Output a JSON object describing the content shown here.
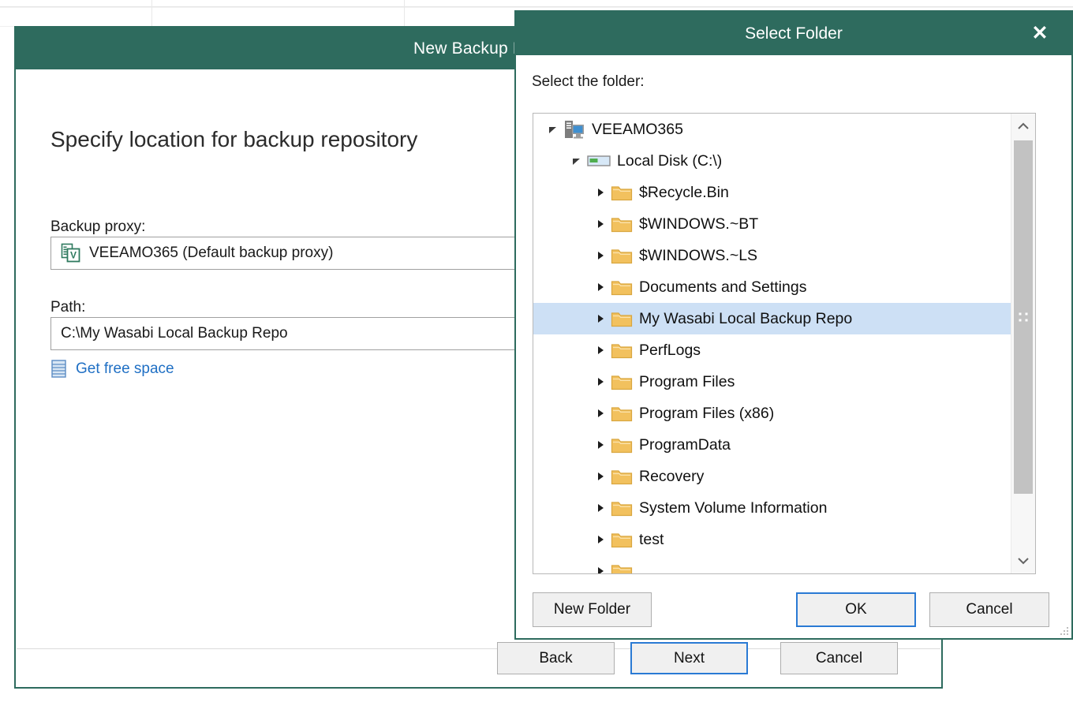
{
  "background": {
    "grid_lines_color": "#e8e8e8"
  },
  "wizard": {
    "title": "New Backup Rep",
    "heading": "Specify location for backup repository",
    "proxy": {
      "label": "Backup proxy:",
      "icon": "veeam-proxy-icon",
      "value": "VEEAMO365 (Default backup proxy)"
    },
    "path": {
      "label": "Path:",
      "value": "C:\\My Wasabi Local Backup Repo"
    },
    "free_space": {
      "icon": "database-icon",
      "label": "Get free space"
    },
    "buttons": {
      "back": "Back",
      "next": "Next",
      "cancel": "Cancel"
    },
    "accent_color": "#2e6b5e",
    "focus_color": "#2a7ad4"
  },
  "folder_dialog": {
    "title": "Select Folder",
    "close_icon": "close-icon",
    "prompt": "Select the folder:",
    "tree": [
      {
        "label": "VEEAMO365",
        "indent": 0,
        "icon": "computer-icon",
        "twisty": "expanded",
        "selected": false
      },
      {
        "label": "Local Disk (C:\\)",
        "indent": 1,
        "icon": "drive-icon",
        "twisty": "expanded",
        "selected": false
      },
      {
        "label": "$Recycle.Bin",
        "indent": 2,
        "icon": "folder-icon",
        "twisty": "collapsed",
        "selected": false
      },
      {
        "label": "$WINDOWS.~BT",
        "indent": 2,
        "icon": "folder-icon",
        "twisty": "collapsed",
        "selected": false
      },
      {
        "label": "$WINDOWS.~LS",
        "indent": 2,
        "icon": "folder-icon",
        "twisty": "collapsed",
        "selected": false
      },
      {
        "label": "Documents and Settings",
        "indent": 2,
        "icon": "folder-icon",
        "twisty": "collapsed",
        "selected": false
      },
      {
        "label": "My Wasabi Local Backup Repo",
        "indent": 2,
        "icon": "folder-icon",
        "twisty": "collapsed",
        "selected": true
      },
      {
        "label": "PerfLogs",
        "indent": 2,
        "icon": "folder-icon",
        "twisty": "collapsed",
        "selected": false
      },
      {
        "label": "Program Files",
        "indent": 2,
        "icon": "folder-icon",
        "twisty": "collapsed",
        "selected": false
      },
      {
        "label": "Program Files (x86)",
        "indent": 2,
        "icon": "folder-icon",
        "twisty": "collapsed",
        "selected": false
      },
      {
        "label": "ProgramData",
        "indent": 2,
        "icon": "folder-icon",
        "twisty": "collapsed",
        "selected": false
      },
      {
        "label": "Recovery",
        "indent": 2,
        "icon": "folder-icon",
        "twisty": "collapsed",
        "selected": false
      },
      {
        "label": "System Volume Information",
        "indent": 2,
        "icon": "folder-icon",
        "twisty": "collapsed",
        "selected": false
      },
      {
        "label": "test",
        "indent": 2,
        "icon": "folder-icon",
        "twisty": "collapsed",
        "selected": false
      },
      {
        "label": "",
        "indent": 2,
        "icon": "folder-icon",
        "twisty": "collapsed",
        "selected": false
      }
    ],
    "scrollbar": {
      "up_icon": "chevron-up-icon",
      "down_icon": "chevron-down-icon",
      "grip_icon": "scrollbar-grip-icon"
    },
    "buttons": {
      "new_folder": "New Folder",
      "ok": "OK",
      "cancel": "Cancel"
    },
    "resize_grip": "resize-grip-icon"
  }
}
